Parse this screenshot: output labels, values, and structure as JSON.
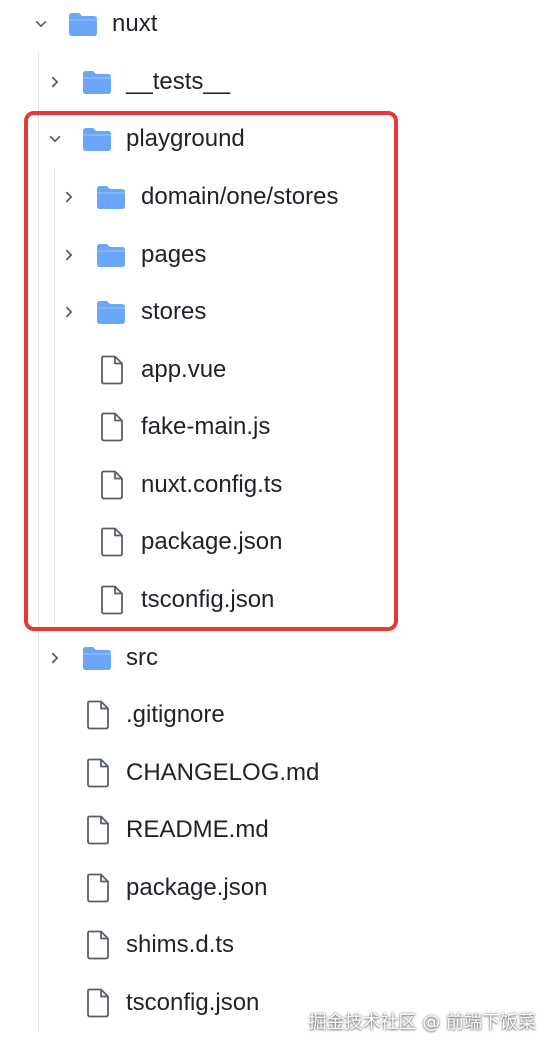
{
  "tree": {
    "root": {
      "label": "nuxt",
      "expanded": true
    },
    "items": [
      {
        "label": "__tests__",
        "type": "folder",
        "expanded": false
      },
      {
        "label": "playground",
        "type": "folder",
        "expanded": true,
        "children": [
          {
            "label": "domain/one/stores",
            "type": "folder",
            "expanded": false
          },
          {
            "label": "pages",
            "type": "folder",
            "expanded": false
          },
          {
            "label": "stores",
            "type": "folder",
            "expanded": false
          },
          {
            "label": "app.vue",
            "type": "file"
          },
          {
            "label": "fake-main.js",
            "type": "file"
          },
          {
            "label": "nuxt.config.ts",
            "type": "file"
          },
          {
            "label": "package.json",
            "type": "file"
          },
          {
            "label": "tsconfig.json",
            "type": "file"
          }
        ]
      },
      {
        "label": "src",
        "type": "folder",
        "expanded": false
      },
      {
        "label": ".gitignore",
        "type": "file"
      },
      {
        "label": "CHANGELOG.md",
        "type": "file"
      },
      {
        "label": "README.md",
        "type": "file"
      },
      {
        "label": "package.json",
        "type": "file"
      },
      {
        "label": "shims.d.ts",
        "type": "file"
      },
      {
        "label": "tsconfig.json",
        "type": "file"
      }
    ]
  },
  "watermark": "掘金技术社区 @ 前端下饭菜",
  "colors": {
    "folder": "#6aa6f8",
    "highlight": "#e53935",
    "chevron": "#57606a",
    "fileStroke": "#57606a"
  },
  "icons": {
    "folder": "folder-icon",
    "file": "file-icon",
    "collapsed": "chevron-right-icon",
    "expanded": "chevron-down-icon"
  }
}
